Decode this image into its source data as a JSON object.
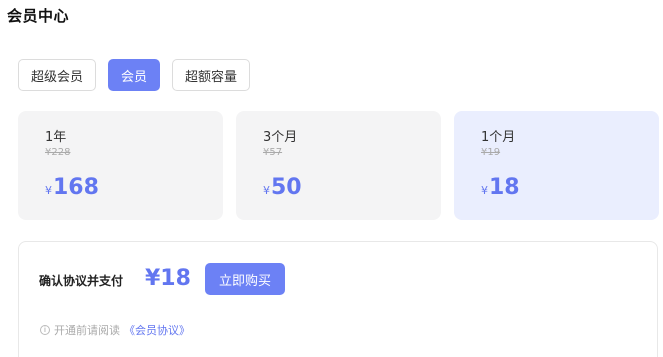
{
  "title": "会员中心",
  "tabs": [
    {
      "label": "超级会员",
      "active": false
    },
    {
      "label": "会员",
      "active": true
    },
    {
      "label": "超额容量",
      "active": false
    }
  ],
  "plans": [
    {
      "name": "1年",
      "original": "¥228",
      "currency": "¥",
      "price": "168",
      "selected": false
    },
    {
      "name": "3个月",
      "original": "¥57",
      "currency": "¥",
      "price": "50",
      "selected": false
    },
    {
      "name": "1个月",
      "original": "¥19",
      "currency": "¥",
      "price": "18",
      "selected": true
    }
  ],
  "payment": {
    "label": "确认协议并支付",
    "amount": "¥18",
    "buy_label": "立即购买",
    "notice_prefix": "开通前请阅读",
    "agreement_link": "《会员协议》",
    "info_icon": "info-circle-icon"
  },
  "colors": {
    "accent": "#6c81f5",
    "price": "#6276f0",
    "selected_card": "#eaeefe",
    "card": "#f4f4f5"
  }
}
